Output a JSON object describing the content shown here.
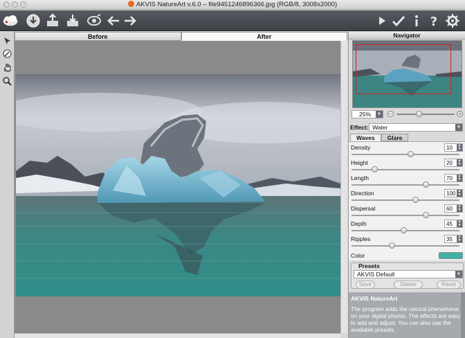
{
  "window": {
    "title": "AKVIS NatureArt v.6.0 – file9451246896366.jpg (RGB/8, 3008x2000)"
  },
  "toolbar": {
    "left_icons": [
      "app-logo-icon",
      "open-icon",
      "save-icon",
      "print-icon",
      "brush-icon",
      "undo-arrow-icon",
      "redo-arrow-icon"
    ],
    "right_icons": [
      "run-icon",
      "apply-checkmark-icon",
      "info-icon",
      "help-icon",
      "settings-gear-icon"
    ]
  },
  "left_tools": [
    "arrow-select-icon",
    "eyedropper-icon",
    "hand-icon",
    "zoom-icon"
  ],
  "view_tabs": {
    "before": "Before",
    "after": "After",
    "active": "After"
  },
  "navigator": {
    "title": "Navigator",
    "zoom": "25%",
    "zoom_out": "−",
    "zoom_in": "+",
    "zoom_level": 0.36
  },
  "effect": {
    "label": "Effect:",
    "value": "Water"
  },
  "subtabs": {
    "waves": "Waves",
    "glare": "Glare",
    "active": "Waves"
  },
  "params": [
    {
      "label": "Density",
      "value": "10",
      "fraction": 0.55
    },
    {
      "label": "Height",
      "value": "20",
      "fraction": 0.2
    },
    {
      "label": "Length",
      "value": "70",
      "fraction": 0.7
    },
    {
      "label": "Direction",
      "value": "100",
      "fraction": 0.6
    },
    {
      "label": "Dispersal",
      "value": "60",
      "fraction": 0.7
    },
    {
      "label": "Depth",
      "value": "45",
      "fraction": 0.48
    },
    {
      "label": "Ripples",
      "value": "35",
      "fraction": 0.37
    }
  ],
  "color": {
    "label": "Color",
    "value": "#3fb2a8"
  },
  "presets": {
    "title": "Presets",
    "selected": "AKVIS Default",
    "save": "Save",
    "delete": "Delete",
    "reset": "Reset"
  },
  "hint": {
    "title": "AKVIS NatureArt",
    "text": "The program adds the natural phenomena on your digital photos. The effects are easy to add and adjust. You can also use the available presets."
  },
  "colors": {
    "toolbar_bg": "#4a4d53",
    "water": "#3f8f8c",
    "ice": "#6fb6cf",
    "sky": "#c4c8cf"
  }
}
